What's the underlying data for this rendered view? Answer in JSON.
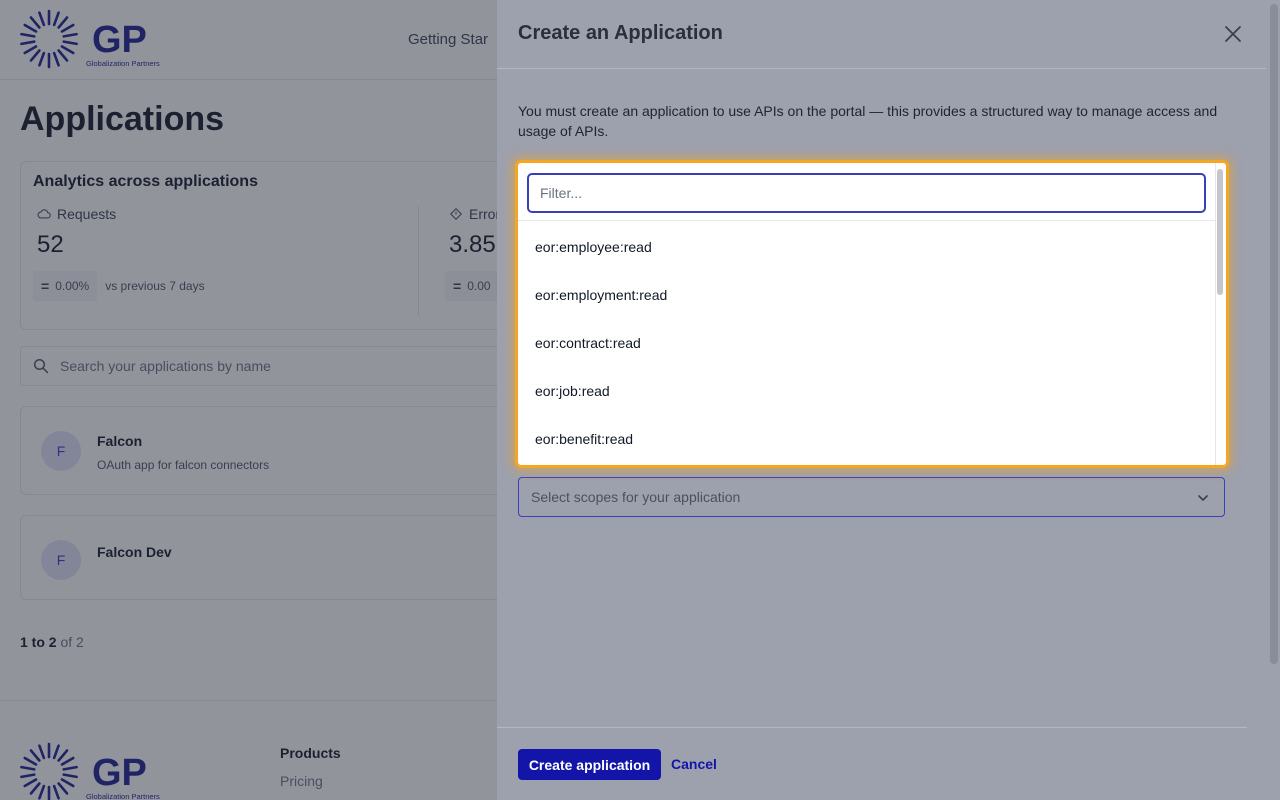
{
  "brand": {
    "logo_text": "GP",
    "tagline": "Globalization Partners"
  },
  "nav": {
    "getting_started": "Getting Star"
  },
  "page": {
    "title": "Applications"
  },
  "analytics": {
    "title": "Analytics across applications",
    "metrics": [
      {
        "label": "Requests",
        "value": "52",
        "change": "0.00%",
        "comparison": "vs previous 7 days",
        "icon": "cloud-icon"
      },
      {
        "label": "Error",
        "value": "3.85",
        "change": "0.00",
        "icon": "diamond-icon"
      }
    ]
  },
  "search": {
    "placeholder": "Search your applications by name"
  },
  "applications": [
    {
      "initial": "F",
      "name": "Falcon",
      "description": "OAuth app for falcon connectors"
    },
    {
      "initial": "F",
      "name": "Falcon Dev",
      "description": ""
    }
  ],
  "pagination": {
    "range": "1 to 2",
    "total": "of 2"
  },
  "footer": {
    "heading": "Products",
    "link": "Pricing"
  },
  "drawer": {
    "title": "Create an Application",
    "intro": "You must create an application to use APIs on the portal — this provides a structured way to manage access and usage of APIs.",
    "scope_placeholder": "Select scopes for your application",
    "create_label": "Create application",
    "cancel_label": "Cancel"
  },
  "dropdown": {
    "filter_placeholder": "Filter...",
    "options": [
      "eor:employee:read",
      "eor:employment:read",
      "eor:contract:read",
      "eor:job:read",
      "eor:benefit:read"
    ]
  },
  "colors": {
    "brand": "#1315a8",
    "highlight": "#f5a623"
  }
}
